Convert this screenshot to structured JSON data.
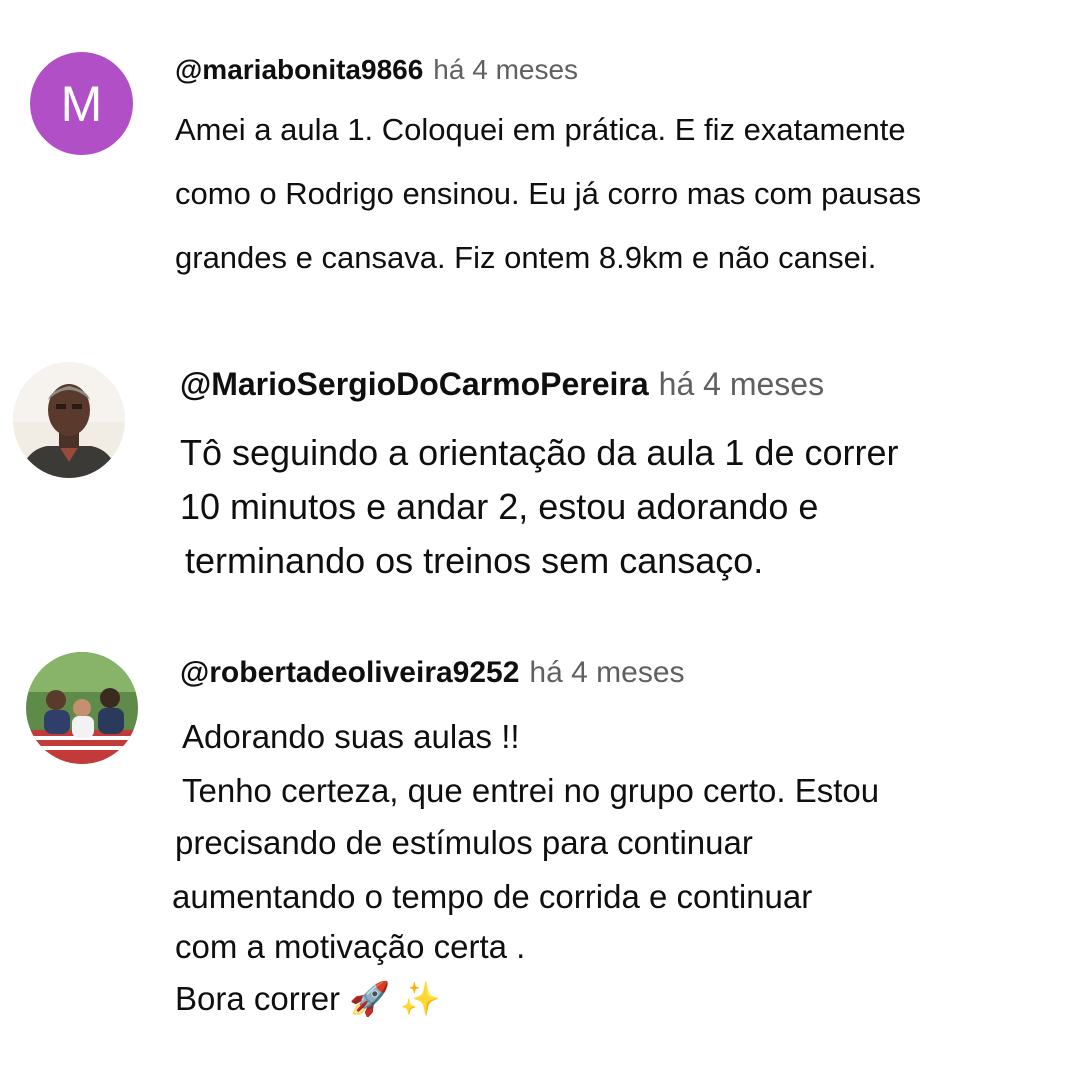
{
  "comments": [
    {
      "author": "@mariabonita9866",
      "time": "há 4 meses",
      "avatar_letter": "M",
      "lines": [
        "Amei a aula 1. Coloquei em prática. E fiz exatamente",
        "como o Rodrigo ensinou. Eu já corro mas com pausas",
        "grandes e cansava. Fiz ontem 8.9km e não cansei."
      ]
    },
    {
      "author": "@MarioSergioDoCarmoPereira",
      "time": "há 4 meses",
      "lines": [
        "Tô seguindo a orientação da aula 1 de correr",
        "10 minutos e andar 2, estou adorando e",
        "terminando os treinos sem cansaço."
      ]
    },
    {
      "author": "@robertadeoliveira9252",
      "time": "há 4 meses",
      "lines": [
        "Adorando suas aulas !!",
        "Tenho certeza,  que entrei no grupo certo. Estou",
        "precisando de estímulos para continuar",
        "aumentando o tempo de corrida e continuar",
        "com a motivação certa .",
        "Bora correr 🚀 ✨"
      ]
    }
  ],
  "colors": {
    "avatar_m": "#b04fc6",
    "text": "#0f0f0f",
    "meta": "#606060"
  }
}
